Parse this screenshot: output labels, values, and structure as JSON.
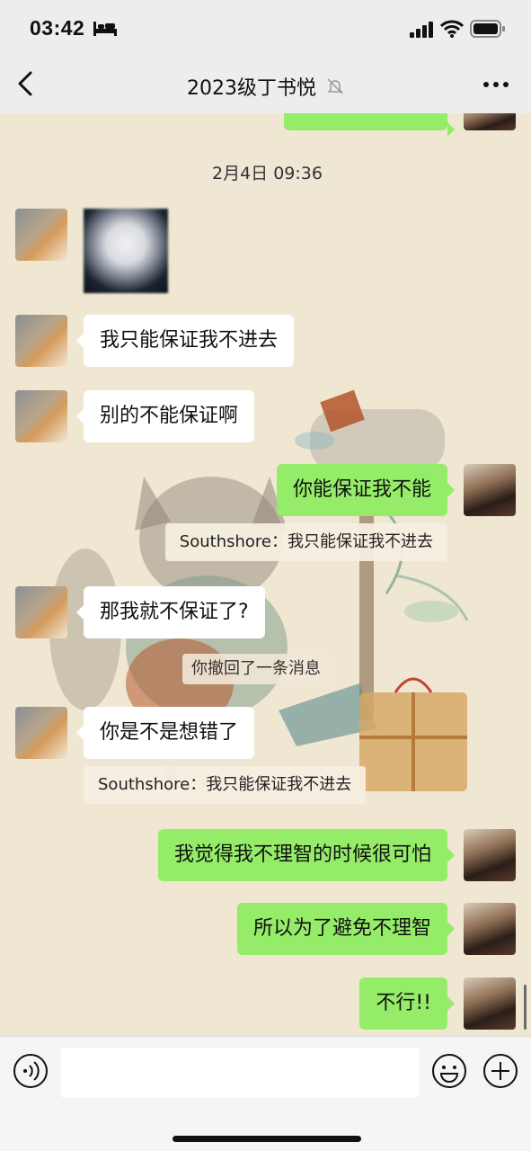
{
  "status_bar": {
    "time": "03:42",
    "icons": [
      "bed-icon",
      "signal-icon",
      "wifi-icon",
      "battery-icon"
    ]
  },
  "nav": {
    "title": "2023级丁书悦",
    "icons": [
      "back-chevron-icon",
      "mute-bell-icon",
      "more-dots-icon"
    ]
  },
  "chat": {
    "timestamp": "2月4日 09:36",
    "messages": [
      {
        "side": "left",
        "type": "image",
        "text": ""
      },
      {
        "side": "left",
        "type": "text",
        "text": "我只能保证我不进去"
      },
      {
        "side": "left",
        "type": "text",
        "text": "别的不能保证啊"
      },
      {
        "side": "right",
        "type": "text",
        "text": "你能保证我不能"
      },
      {
        "side": "quote",
        "text": "Southshore：我只能保证我不进去"
      },
      {
        "side": "left",
        "type": "text",
        "text": "那我就不保证了?"
      },
      {
        "side": "system",
        "text": "你撤回了一条消息"
      },
      {
        "side": "left",
        "type": "text",
        "text": "你是不是想错了"
      },
      {
        "side": "quote",
        "text": "Southshore：我只能保证我不进去"
      },
      {
        "side": "right",
        "type": "text",
        "text": "我觉得我不理智的时候很可怕"
      },
      {
        "side": "right",
        "type": "text",
        "text": "所以为了避免不理智"
      },
      {
        "side": "right",
        "type": "text",
        "text": "不行!!"
      }
    ]
  },
  "input_bar": {
    "placeholder": "",
    "icons": [
      "voice-icon",
      "emoji-icon",
      "plus-icon"
    ]
  },
  "colors": {
    "right_bubble": "#95ec69",
    "left_bubble": "#ffffff",
    "background": "#efe7d2"
  }
}
